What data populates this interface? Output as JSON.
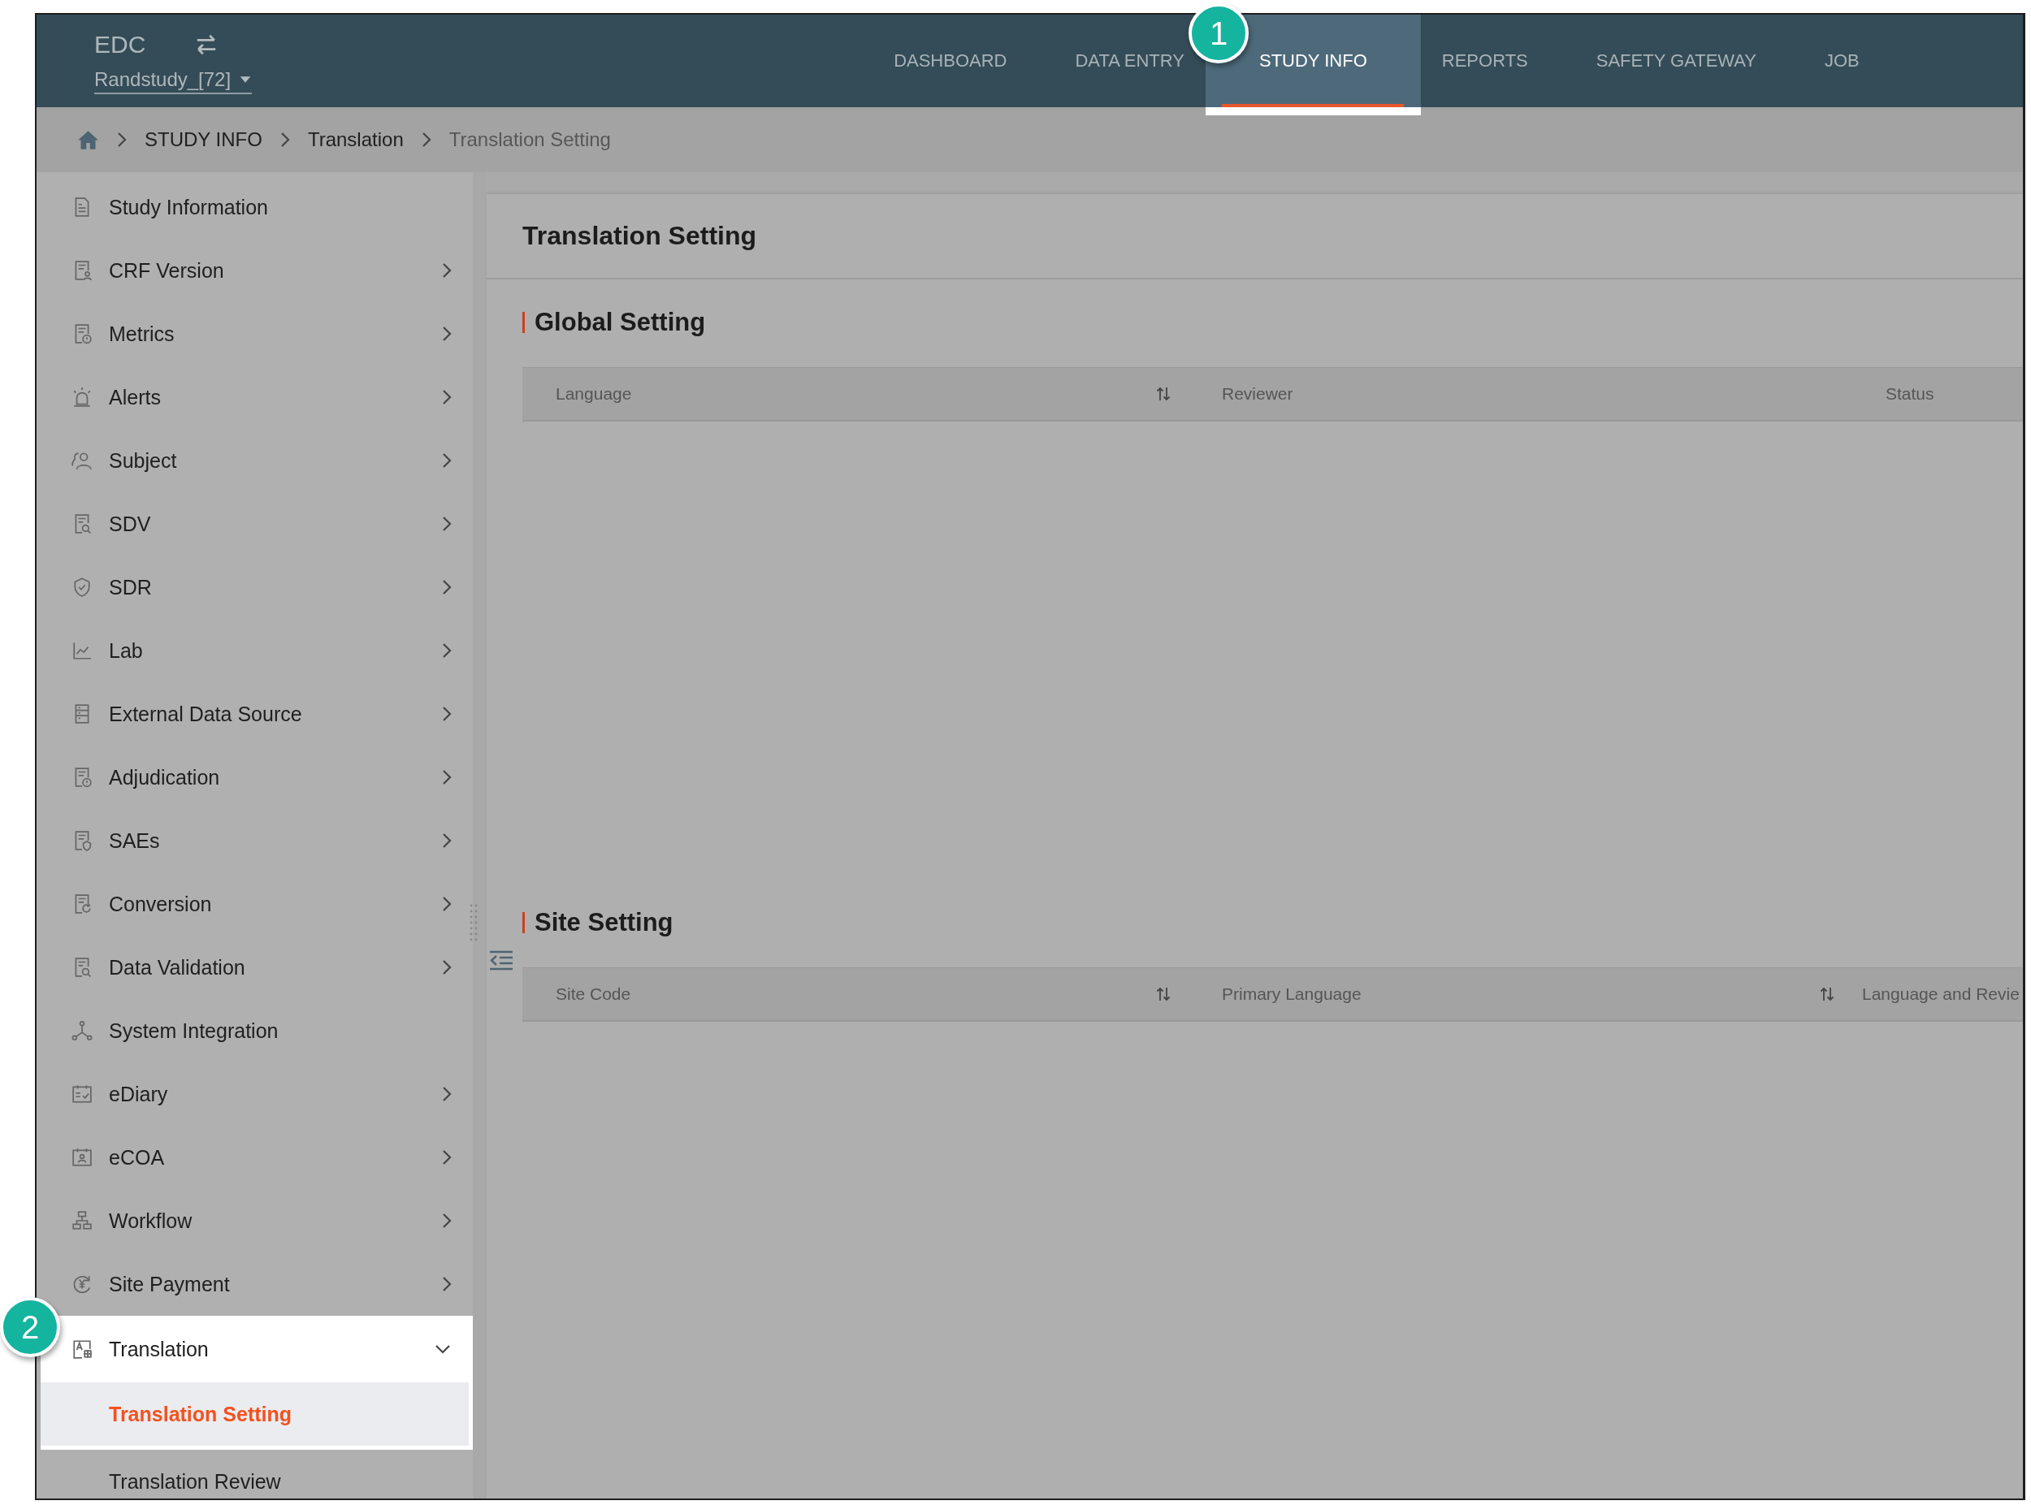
{
  "header": {
    "app_name": "EDC",
    "study": "Randstudy_[72]"
  },
  "nav_tabs": [
    {
      "label": "DASHBOARD",
      "selected": false
    },
    {
      "label": "DATA ENTRY",
      "selected": false
    },
    {
      "label": "STUDY INFO",
      "selected": true
    },
    {
      "label": "REPORTS",
      "selected": false
    },
    {
      "label": "SAFETY GATEWAY",
      "selected": false
    },
    {
      "label": "JOB",
      "selected": false
    }
  ],
  "breadcrumb": [
    {
      "label": "STUDY INFO"
    },
    {
      "label": "Translation"
    },
    {
      "label": "Translation Setting"
    }
  ],
  "sidebar": {
    "items": [
      {
        "label": "Study Information",
        "expandable": false,
        "expanded": false
      },
      {
        "label": "CRF Version",
        "expandable": true,
        "expanded": false
      },
      {
        "label": "Metrics",
        "expandable": true,
        "expanded": false
      },
      {
        "label": "Alerts",
        "expandable": true,
        "expanded": false
      },
      {
        "label": "Subject",
        "expandable": true,
        "expanded": false
      },
      {
        "label": "SDV",
        "expandable": true,
        "expanded": false
      },
      {
        "label": "SDR",
        "expandable": true,
        "expanded": false
      },
      {
        "label": "Lab",
        "expandable": true,
        "expanded": false
      },
      {
        "label": "External Data Source",
        "expandable": true,
        "expanded": false
      },
      {
        "label": "Adjudication",
        "expandable": true,
        "expanded": false
      },
      {
        "label": "SAEs",
        "expandable": true,
        "expanded": false
      },
      {
        "label": "Conversion",
        "expandable": true,
        "expanded": false
      },
      {
        "label": "Data Validation",
        "expandable": true,
        "expanded": false
      },
      {
        "label": "System Integration",
        "expandable": false,
        "expanded": false
      },
      {
        "label": "eDiary",
        "expandable": true,
        "expanded": false
      },
      {
        "label": "eCOA",
        "expandable": true,
        "expanded": false
      },
      {
        "label": "Workflow",
        "expandable": true,
        "expanded": false
      },
      {
        "label": "Site Payment",
        "expandable": true,
        "expanded": false
      },
      {
        "label": "Translation",
        "expandable": true,
        "expanded": true,
        "children": [
          {
            "label": "Translation Setting",
            "selected": true
          },
          {
            "label": "Translation Review",
            "selected": false
          }
        ]
      }
    ]
  },
  "page": {
    "title": "Translation Setting",
    "sections": [
      {
        "title": "Global Setting",
        "columns": [
          {
            "label": "Language",
            "sortable": true
          },
          {
            "label": "Reviewer",
            "sortable": false
          },
          {
            "label": "Status",
            "sortable": false
          }
        ]
      },
      {
        "title": "Site Setting",
        "columns": [
          {
            "label": "Site Code",
            "sortable": true
          },
          {
            "label": "Primary Language",
            "sortable": true
          },
          {
            "label": "Language and Revie",
            "sortable": false
          }
        ]
      }
    ]
  },
  "callouts": [
    {
      "number": "1"
    },
    {
      "number": "2"
    }
  ]
}
